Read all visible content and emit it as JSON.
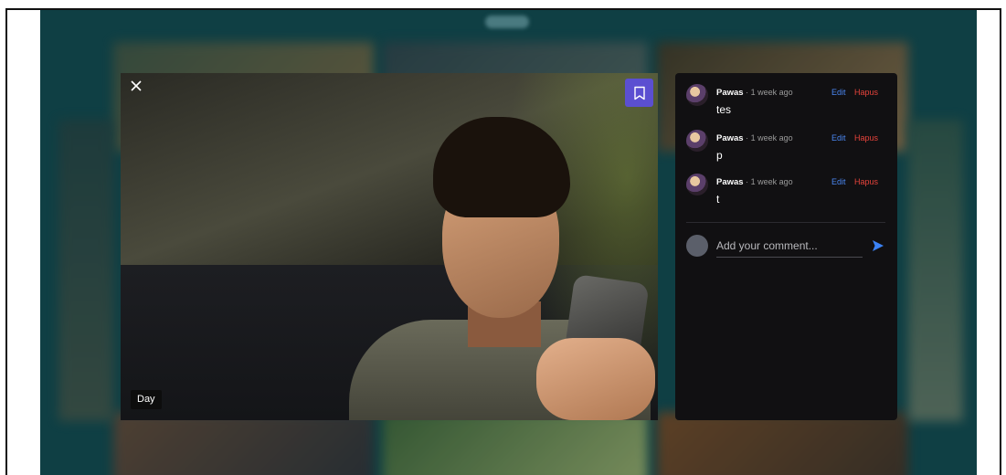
{
  "viewer": {
    "photo_tag": "Day"
  },
  "comments": [
    {
      "author": "Pawas",
      "time": " · 1 week ago",
      "text": "tes",
      "edit_label": "Edit",
      "delete_label": "Hapus"
    },
    {
      "author": "Pawas",
      "time": " · 1 week ago",
      "text": "p",
      "edit_label": "Edit",
      "delete_label": "Hapus"
    },
    {
      "author": "Pawas",
      "time": " · 1 week ago",
      "text": "t",
      "edit_label": "Edit",
      "delete_label": "Hapus"
    }
  ],
  "comment_box": {
    "placeholder": "Add your comment..."
  },
  "icons": {
    "close": "close-icon",
    "bookmark": "bookmark-icon",
    "send": "send-icon"
  },
  "colors": {
    "backdrop": "#0f3f44",
    "bookmark_bg": "#5b4fd1",
    "edit": "#4a86f0",
    "delete": "#e6433b",
    "send": "#3b82f6",
    "panel": "#111012"
  }
}
